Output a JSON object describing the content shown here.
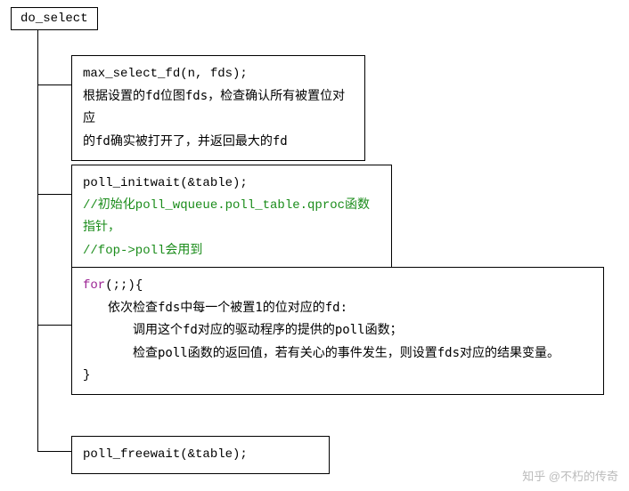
{
  "root": {
    "label": "do_select"
  },
  "node1": {
    "line1": "max_select_fd(n, fds);",
    "line2": "根据设置的fd位图fds，检查确认所有被置位对应",
    "line3": "的fd确实被打开了，并返回最大的fd"
  },
  "node2": {
    "line1": "poll_initwait(&table);",
    "comment1": "//初始化poll_wqueue.poll_table.qproc函数指针，",
    "comment2": "//fop->poll会用到"
  },
  "node3": {
    "for_kw": "for",
    "for_rest": "(;;){",
    "line2": "依次检查fds中每一个被置1的位对应的fd:",
    "line3": "调用这个fd对应的驱动程序的提供的poll函数；",
    "line4": "检查poll函数的返回值，若有关心的事件发生，则设置fds对应的结果变量。",
    "close": "}"
  },
  "node4": {
    "line1": "poll_freewait(&table);"
  },
  "watermark": "知乎 @不朽的传奇"
}
